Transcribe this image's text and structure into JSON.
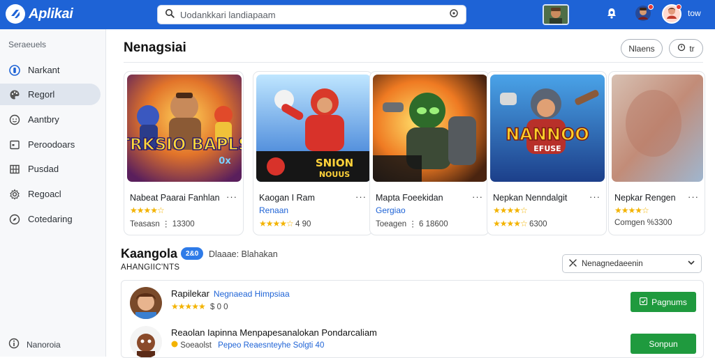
{
  "header": {
    "app_name": "Aplikai",
    "search": {
      "placeholder": "Uodankkari landiapaam",
      "icon": "search-icon"
    },
    "user_label": "tow",
    "accent": "#1e63d6"
  },
  "sidebar": {
    "heading": "Seraeuels",
    "items": [
      {
        "label": "Narkant",
        "icon": "circle-badge-icon",
        "active": false
      },
      {
        "label": "Regorl",
        "icon": "palette-icon",
        "active": true
      },
      {
        "label": "Aantbry",
        "icon": "face-icon",
        "active": false
      },
      {
        "label": "Peroodoars",
        "icon": "window-icon",
        "active": false
      },
      {
        "label": "Pusdad",
        "icon": "grid-icon",
        "active": false
      },
      {
        "label": "Regoacl",
        "icon": "settings-icon",
        "active": false
      },
      {
        "label": "Cotedaring",
        "icon": "compass-icon",
        "active": false
      }
    ],
    "footer": {
      "label": "Nanoroia",
      "icon": "info-icon"
    }
  },
  "featured": {
    "title": "Nenagsiai",
    "btn_left": "Nlaens",
    "btn_right": "tr",
    "cards": [
      {
        "title": "Nabeat Paarai Fanhlan",
        "stars": "★★★★☆",
        "sub": "",
        "meta": "Teasasn ⋮ 13300",
        "art_text": "TRKSIO BAPLS",
        "art_sub": "0x"
      },
      {
        "title": "Kaogan I Ram",
        "stars": "★★★★☆",
        "sub": "Renaan",
        "meta": "4 90",
        "art_text": "SNION",
        "art_sub": "NOUUS"
      },
      {
        "title": "Mapta Foeekidan",
        "stars": "",
        "sub": "Gergiao",
        "meta": "Toeagen ⋮ 6 18600",
        "art_text": "",
        "art_sub": ""
      },
      {
        "title": "Nepkan Nenndalgit",
        "stars": "★★★★☆",
        "sub": "",
        "meta": "6300",
        "art_text": "NANNOO",
        "art_sub": "EFUSE"
      },
      {
        "title": "Nepkar Rengen",
        "stars": "★★★★☆",
        "sub": "",
        "meta": "Comgen %3300",
        "art_text": "",
        "art_sub": ""
      }
    ]
  },
  "section2": {
    "title": "Kaangola",
    "badge": "2&0",
    "description": "Dlaaae: Blahakan",
    "subtitle": "AHANGIIC'NTS",
    "sort_label": "Nenagnedaeenin",
    "rows": [
      {
        "title": "Rapilekar",
        "title_link": "Negnaead Himpsiaa",
        "stars": "★★★★★",
        "meta_plain": "$ 0 0",
        "meta_link": "",
        "button": "Pagnums"
      },
      {
        "title": "Reaolan Iapinna Menpapesanalokan Pondarcaliam",
        "title_link": "",
        "stars": "",
        "meta_plain": "Soeaolst",
        "meta_link": "Pepeo  Reaesnteyhe  Solgti 40",
        "button": "Sonpun"
      }
    ]
  }
}
